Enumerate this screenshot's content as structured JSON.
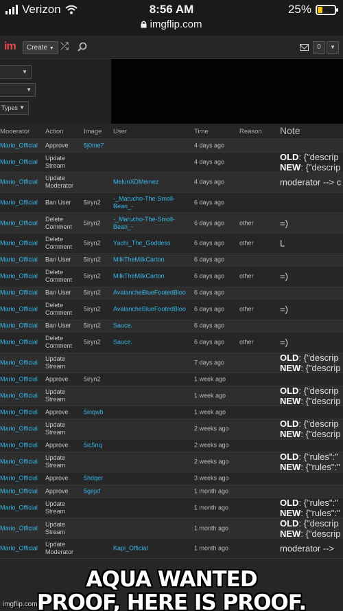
{
  "status_bar": {
    "carrier": "Verizon",
    "time": "8:56 AM",
    "url": "imgflip.com",
    "battery": "25%",
    "battery_level": 0.25
  },
  "nav": {
    "logo": "im",
    "create_label": "Create",
    "notification_count": "0"
  },
  "filters": {
    "select_3_label": "Types"
  },
  "table": {
    "headers": {
      "moderator": "Moderator",
      "action": "Action",
      "image": "Image",
      "user": "User",
      "time": "Time",
      "reason": "Reason",
      "note": "Note"
    },
    "rows": [
      {
        "moderator": "Mario_Official",
        "action": "Approve",
        "image": "5j0me7",
        "user": "",
        "time": "4 days ago",
        "reason": "",
        "note": "",
        "tall": false
      },
      {
        "moderator": "Mario_Official",
        "action": "Update Stream",
        "image": "",
        "user": "",
        "time": "4 days ago",
        "reason": "",
        "note_old": "{\"descrip",
        "note_new": "{\"descrip",
        "tall": true
      },
      {
        "moderator": "Mario_Official",
        "action": "Update Moderator",
        "image": "",
        "user": "MelunXDMemez",
        "time": "4 days ago",
        "reason": "",
        "note": "moderator --> c",
        "tall": true
      },
      {
        "moderator": "Mario_Official",
        "action": "Ban User",
        "image": "5iryn2",
        "user": "-_Marucho-The-Smoll-Bean_-",
        "time": "6 days ago",
        "reason": "",
        "note": "",
        "tall": true
      },
      {
        "moderator": "Mario_Official",
        "action": "Delete Comment",
        "image": "5iryn2",
        "user": "-_Marucho-The-Smoll-Bean_-",
        "time": "6 days ago",
        "reason": "other",
        "note": "=)",
        "tall": true
      },
      {
        "moderator": "Mario_Official",
        "action": "Delete Comment",
        "image": "5iryn2",
        "user": "Yachi_The_Goddess",
        "time": "6 days ago",
        "reason": "other",
        "note": "L",
        "tall": true
      },
      {
        "moderator": "Mario_Official",
        "action": "Ban User",
        "image": "5iryn2",
        "user": "MilkTheMilkCarton",
        "time": "6 days ago",
        "reason": "",
        "note": "",
        "tall": false
      },
      {
        "moderator": "Mario_Official",
        "action": "Delete Comment",
        "image": "5iryn2",
        "user": "MilkTheMilkCarton",
        "time": "6 days ago",
        "reason": "other",
        "note": "=)",
        "tall": true
      },
      {
        "moderator": "Mario_Official",
        "action": "Ban User",
        "image": "5iryn2",
        "user": "AvalancheBlueFootedBloo",
        "time": "6 days ago",
        "reason": "",
        "note": "",
        "tall": false
      },
      {
        "moderator": "Mario_Official",
        "action": "Delete Comment",
        "image": "5iryn2",
        "user": "AvalancheBlueFootedBloo",
        "time": "6 days ago",
        "reason": "other",
        "note": "=)",
        "tall": true
      },
      {
        "moderator": "Mario_Official",
        "action": "Ban User",
        "image": "5iryn2",
        "user": "Sauce.",
        "time": "6 days ago",
        "reason": "",
        "note": "",
        "tall": false
      },
      {
        "moderator": "Mario_Official",
        "action": "Delete Comment",
        "image": "5iryn2",
        "user": "Sauce.",
        "time": "6 days ago",
        "reason": "other",
        "note": "=)",
        "tall": true
      },
      {
        "moderator": "Mario_Official",
        "action": "Update Stream",
        "image": "",
        "user": "",
        "time": "7 days ago",
        "reason": "",
        "note_old": "{\"descrip",
        "note_new": "{\"descrip",
        "tall": true
      },
      {
        "moderator": "Mario_Official",
        "action": "Approve",
        "image": "5iryn2",
        "user": "",
        "time": "1 week ago",
        "reason": "",
        "note": "",
        "tall": false
      },
      {
        "moderator": "Mario_Official",
        "action": "Update Stream",
        "image": "",
        "user": "",
        "time": "1 week ago",
        "reason": "",
        "note_old": "{\"descrip",
        "note_new": "{\"descrip",
        "tall": true
      },
      {
        "moderator": "Mario_Official",
        "action": "Approve",
        "image": "5inqwb",
        "user": "",
        "time": "1 week ago",
        "reason": "",
        "note": "",
        "tall": false
      },
      {
        "moderator": "Mario_Official",
        "action": "Update Stream",
        "image": "",
        "user": "",
        "time": "2 weeks ago",
        "reason": "",
        "note_old": "{\"descrip",
        "note_new": "{\"descrip",
        "tall": true
      },
      {
        "moderator": "Mario_Official",
        "action": "Approve",
        "image": "5ic5nq",
        "user": "",
        "time": "2 weeks ago",
        "reason": "",
        "note": "",
        "tall": false
      },
      {
        "moderator": "Mario_Official",
        "action": "Update Stream",
        "image": "",
        "user": "",
        "time": "2 weeks ago",
        "reason": "",
        "note_old": "{\"rules\":\"",
        "note_new": "{\"rules\":\"",
        "tall": true
      },
      {
        "moderator": "Mario_Official",
        "action": "Approve",
        "image": "5hdqer",
        "user": "",
        "time": "3 weeks ago",
        "reason": "",
        "note": "",
        "tall": false
      },
      {
        "moderator": "Mario_Official",
        "action": "Approve",
        "image": "5gejxf",
        "user": "",
        "time": "1 month ago",
        "reason": "",
        "note": "",
        "tall": false
      },
      {
        "moderator": "Mario_Official",
        "action": "Update Stream",
        "image": "",
        "user": "",
        "time": "1 month ago",
        "reason": "",
        "note_old": "{\"rules\":\"",
        "note_new": "{\"rules\":\"",
        "tall": true
      },
      {
        "moderator": "Mario_Official",
        "action": "Update Stream",
        "image": "",
        "user": "",
        "time": "1 month ago",
        "reason": "",
        "note_old": "{\"descrip",
        "note_new": "{\"descrip",
        "tall": true
      },
      {
        "moderator": "Mario_Official",
        "action": "Update Moderator",
        "image": "",
        "user": "Kapi_Official",
        "time": "1 month ago",
        "reason": "",
        "note": "moderator -->",
        "tall": true
      }
    ]
  },
  "meme_caption": {
    "line1": "AQUA WANTED",
    "line2": "PROOF, HERE IS PROOF."
  },
  "watermark": "imgflip.com",
  "colors": {
    "link": "#35b6e8",
    "logo": "#e8474c",
    "battery": "#f5c518"
  }
}
